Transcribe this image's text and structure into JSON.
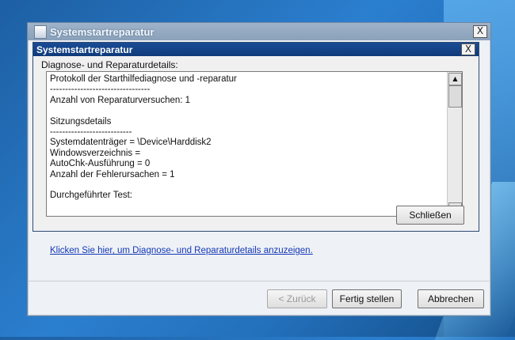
{
  "outer_window": {
    "title": "Systemstartreparatur",
    "close_label": "X"
  },
  "dialog": {
    "title": "Systemstartreparatur",
    "close_label": "X",
    "details_label": "Diagnose- und Reparaturdetails:",
    "log_lines": [
      "Protokoll der Starthilfediagnose und -reparatur",
      "---------------------------------",
      "Anzahl von Reparaturversuchen: 1",
      "",
      "Sitzungsdetails",
      "---------------------------",
      "Systemdatenträger = \\Device\\Harddisk2",
      "Windowsverzeichnis =",
      "AutoChk-Ausführung = 0",
      "Anzahl der Fehlerursachen = 1",
      "",
      "Durchgeführter Test:"
    ],
    "scroll_up": "▲",
    "scroll_down": "▼",
    "close_button_label": "Schließen"
  },
  "link_text": "Klicken Sie hier, um Diagnose- und Reparaturdetails anzuzeigen.",
  "buttons": {
    "back_label": "< Zurück",
    "finish_label": "Fertig stellen",
    "cancel_label": "Abbrechen"
  },
  "colors": {
    "desktop": "#2470be",
    "dialog_titlebar": "#163f84",
    "link": "#1438b8"
  }
}
